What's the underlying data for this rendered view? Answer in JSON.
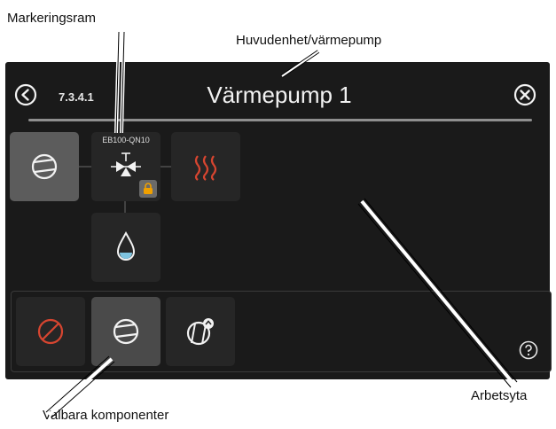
{
  "callouts": {
    "markeringsram": "Markeringsram",
    "huvudenhet": "Huvudenhet/värmepump",
    "arbetsyta": "Arbetsyta",
    "valbara": "Valbara komponenter"
  },
  "header": {
    "menu_number": "7.3.4.1",
    "title": "Värmepump 1"
  },
  "components": {
    "valve_tag": "EB100-QN10"
  },
  "icons": {
    "back": "back-icon",
    "close": "close-icon",
    "compressor": "compressor-icon",
    "valve": "three-way-valve-icon",
    "heat": "heating-icon",
    "water": "hot-water-icon",
    "lock": "lock-icon",
    "none": "none-icon",
    "pool_compressor": "cooling-compressor-icon",
    "help": "help-icon"
  },
  "colors": {
    "screen": "#1a1a1a",
    "tile": "#262626",
    "tile_active": "#5c5c5c",
    "heat_red": "#d64530",
    "lock_orange": "#f0a000",
    "water_blue": "#7fc4e0"
  }
}
